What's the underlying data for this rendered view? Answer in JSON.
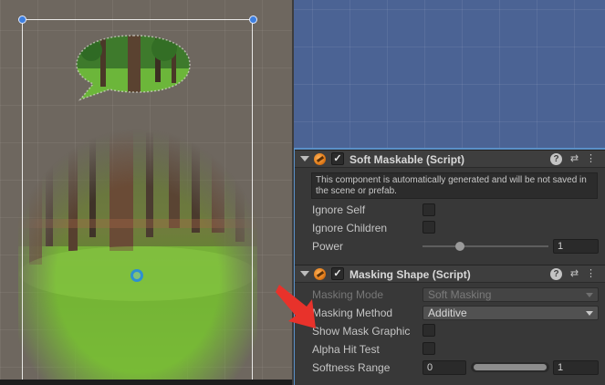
{
  "scene": {
    "preview_label": ""
  },
  "soft_maskable": {
    "title": "Soft Maskable (Script)",
    "info": "This component is automatically generated and will be not saved in the scene or prefab.",
    "props": {
      "ignore_self": "Ignore Self",
      "ignore_children": "Ignore Children",
      "power": "Power",
      "power_value": "1",
      "power_level": 0.3
    }
  },
  "masking_shape": {
    "title": "Masking Shape (Script)",
    "props": {
      "masking_mode": "Masking Mode",
      "masking_mode_value": "Soft Masking",
      "masking_method": "Masking Method",
      "masking_method_value": "Additive",
      "show_mask_graphic": "Show Mask Graphic",
      "alpha_hit_test": "Alpha Hit Test",
      "softness_range": "Softness Range",
      "softness_min": "0",
      "softness_max": "1"
    }
  },
  "icons": {
    "component": "script-component-icon",
    "help": "help-icon",
    "preset": "preset-sliders-icon",
    "menu": "kebab-menu-icon"
  },
  "colors": {
    "inspector_bg": "#383838",
    "header_bg": "#3e3e3e",
    "accent_arrow": "#e8322b",
    "handle_blue": "#3d7fe0"
  }
}
